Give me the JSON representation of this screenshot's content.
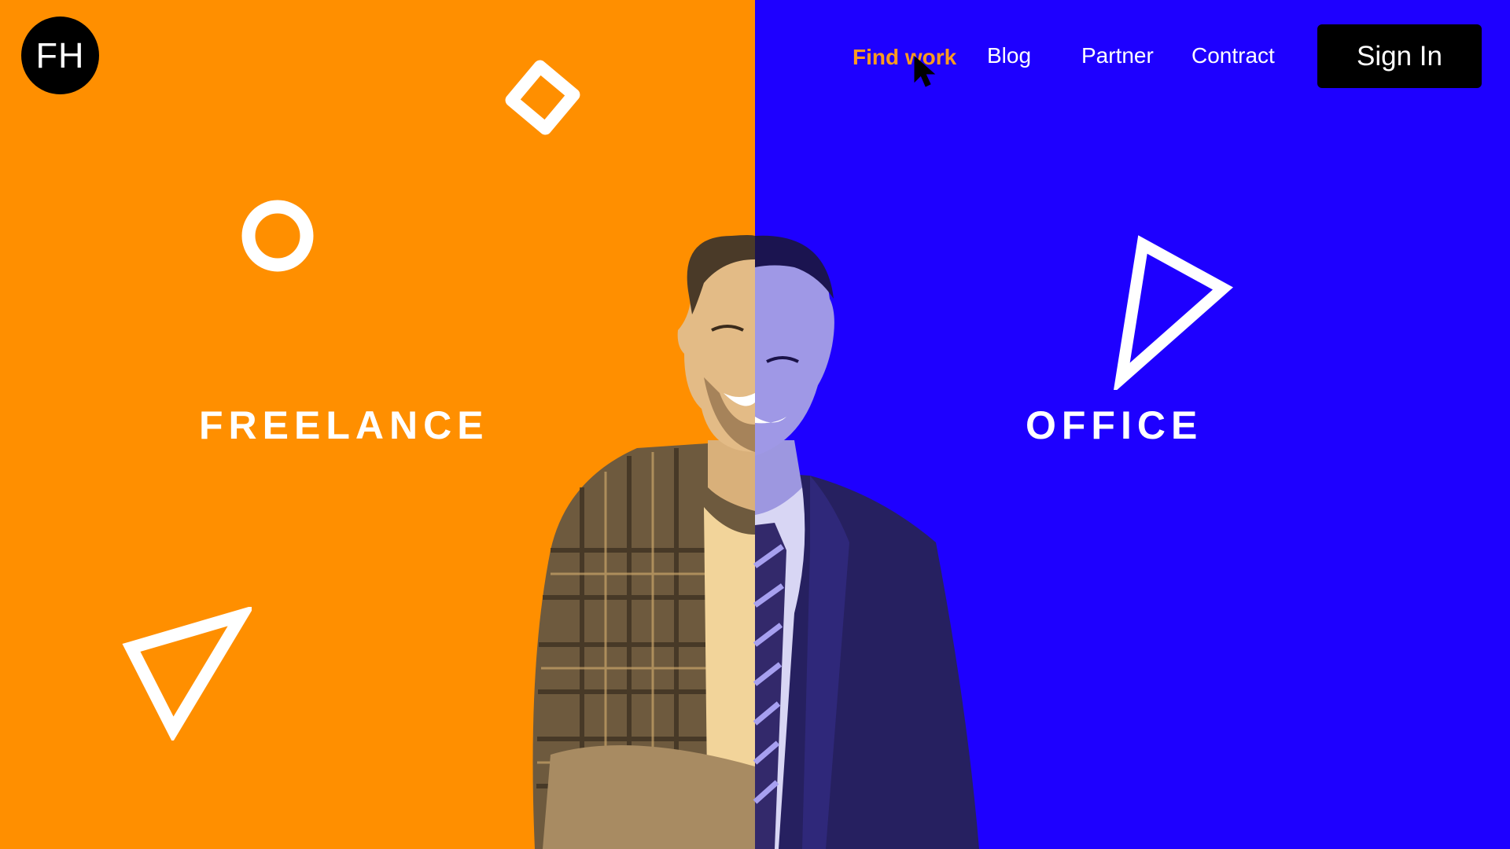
{
  "logo": {
    "text": "FH"
  },
  "nav": {
    "items": [
      {
        "label": "Find work",
        "active": true
      },
      {
        "label": "Blog",
        "active": false
      },
      {
        "label": "Partner",
        "active": false
      },
      {
        "label": "Contract",
        "active": false
      }
    ],
    "signin_label": "Sign In"
  },
  "hero": {
    "left_heading": "FREELANCE",
    "right_heading": "OFFICE"
  },
  "colors": {
    "left_bg": "#FF8F00",
    "right_bg": "#1E00FF",
    "active_nav": "#FF9B1F",
    "button_bg": "#000000"
  },
  "icons": {
    "cursor": "mouse-pointer-icon",
    "shapes": [
      "diamond-outline-icon",
      "ring-outline-icon",
      "triangle-outline-icon",
      "play-triangle-outline-icon"
    ]
  }
}
